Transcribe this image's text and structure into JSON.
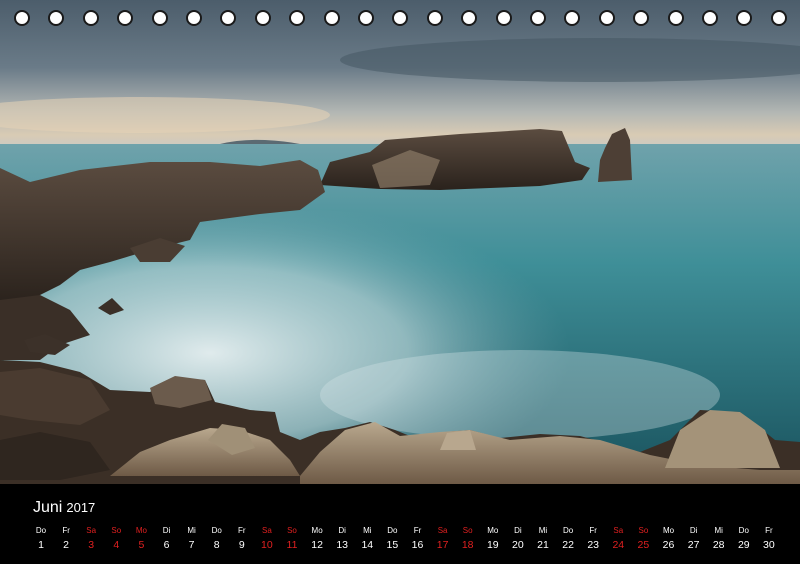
{
  "calendar": {
    "month": "Juni",
    "year": "2017",
    "days": [
      {
        "dow": "Do",
        "n": "1",
        "weekend": false
      },
      {
        "dow": "Fr",
        "n": "2",
        "weekend": false
      },
      {
        "dow": "Sa",
        "n": "3",
        "weekend": true
      },
      {
        "dow": "So",
        "n": "4",
        "weekend": true
      },
      {
        "dow": "Mo",
        "n": "5",
        "weekend": true
      },
      {
        "dow": "Di",
        "n": "6",
        "weekend": false
      },
      {
        "dow": "Mi",
        "n": "7",
        "weekend": false
      },
      {
        "dow": "Do",
        "n": "8",
        "weekend": false
      },
      {
        "dow": "Fr",
        "n": "9",
        "weekend": false
      },
      {
        "dow": "Sa",
        "n": "10",
        "weekend": true
      },
      {
        "dow": "So",
        "n": "11",
        "weekend": true
      },
      {
        "dow": "Mo",
        "n": "12",
        "weekend": false
      },
      {
        "dow": "Di",
        "n": "13",
        "weekend": false
      },
      {
        "dow": "Mi",
        "n": "14",
        "weekend": false
      },
      {
        "dow": "Do",
        "n": "15",
        "weekend": false
      },
      {
        "dow": "Fr",
        "n": "16",
        "weekend": false
      },
      {
        "dow": "Sa",
        "n": "17",
        "weekend": true
      },
      {
        "dow": "So",
        "n": "18",
        "weekend": true
      },
      {
        "dow": "Mo",
        "n": "19",
        "weekend": false
      },
      {
        "dow": "Di",
        "n": "20",
        "weekend": false
      },
      {
        "dow": "Mi",
        "n": "21",
        "weekend": false
      },
      {
        "dow": "Do",
        "n": "22",
        "weekend": false
      },
      {
        "dow": "Fr",
        "n": "23",
        "weekend": false
      },
      {
        "dow": "Sa",
        "n": "24",
        "weekend": true
      },
      {
        "dow": "So",
        "n": "25",
        "weekend": true
      },
      {
        "dow": "Mo",
        "n": "26",
        "weekend": false
      },
      {
        "dow": "Di",
        "n": "27",
        "weekend": false
      },
      {
        "dow": "Mi",
        "n": "28",
        "weekend": false
      },
      {
        "dow": "Do",
        "n": "29",
        "weekend": false
      },
      {
        "dow": "Fr",
        "n": "30",
        "weekend": false
      }
    ]
  },
  "binding_hole_count": 23,
  "colors": {
    "weekend": "#e02020",
    "weekday": "#ffffff",
    "strip_background": "#000000",
    "sea": "#3f8f98",
    "sky": "#5b6e7c"
  }
}
